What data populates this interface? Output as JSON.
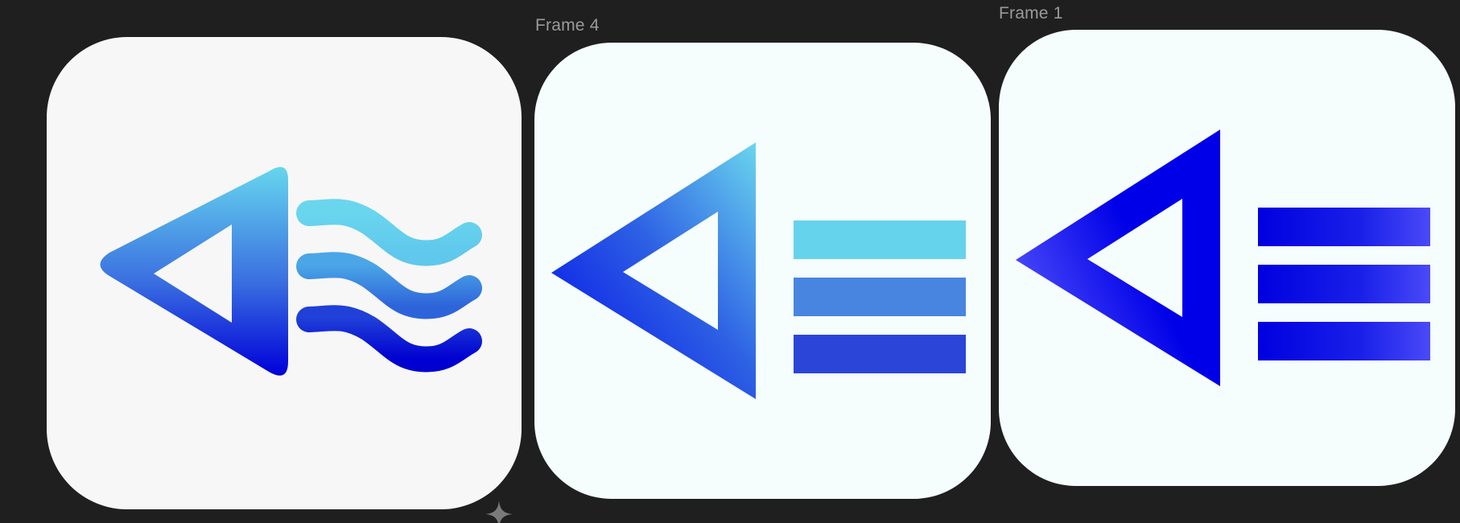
{
  "canvas": {
    "background": "#1f1f1f"
  },
  "frames": [
    {
      "label": "",
      "icon": "speaker-with-sound-waves-icon",
      "colors": {
        "light": "#66d6ee",
        "dark": "#0000d8",
        "background": "#f7f7f7"
      }
    },
    {
      "label": "Frame 4",
      "icon": "triangle-with-three-bars-icon",
      "colors": {
        "light": "#66d6ee",
        "dark": "#0008e8",
        "bar1": "#66d3ec",
        "bar2": "#4785e0",
        "bar3": "#2a45d8",
        "background": "#f6fdfd"
      }
    },
    {
      "label": "Frame 1",
      "icon": "triangle-with-three-bars-icon",
      "colors": {
        "light": "#4a4af8",
        "dark": "#0000e8",
        "background": "#f6fdfd"
      }
    }
  ],
  "overlay": {
    "icon": "sparkle-icon"
  }
}
